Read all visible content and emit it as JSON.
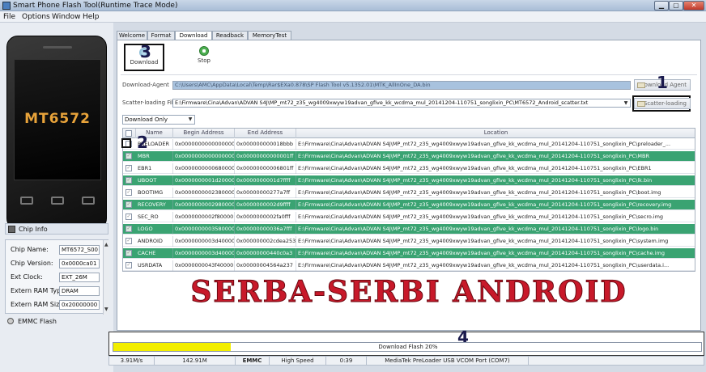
{
  "window": {
    "title": "Smart Phone Flash Tool(Runtime Trace Mode)",
    "min_glyph": "▁",
    "max_glyph": "▢",
    "close_glyph": "✕"
  },
  "menu": [
    "File",
    "Options",
    "Window",
    "Help"
  ],
  "phone": {
    "model": "MT6572"
  },
  "chip_info": {
    "header": "Chip Info",
    "rows": [
      {
        "label": "Chip Name:",
        "value": "MT6572_S00"
      },
      {
        "label": "Chip Version:",
        "value": "0x0000ca01"
      },
      {
        "label": "Ext Clock:",
        "value": "EXT_26M"
      },
      {
        "label": "Extern RAM Type:",
        "value": "DRAM"
      },
      {
        "label": "Extern RAM Size:",
        "value": "0x20000000"
      }
    ],
    "storage": "EMMC Flash"
  },
  "tabs": [
    "Welcome",
    "Format",
    "Download",
    "Readback",
    "MemoryTest"
  ],
  "active_tab": "Download",
  "toolbar": {
    "download_label": "Download",
    "stop_label": "Stop"
  },
  "annotations": {
    "m1": "1",
    "m2": "2",
    "m3": "3",
    "m4": "4"
  },
  "form": {
    "agent_label": "Download-Agent",
    "agent_path": "C:\\Users\\AMC\\AppData\\Local\\Temp\\Rar$EXa0.878\\SP Flash Tool v5.1352.01\\MTK_AllInOne_DA.bin",
    "agent_button": "Download Agent",
    "scatter_label": "Scatter-loading File",
    "scatter_path": "E:\\Firmware\\Cina\\Advan\\ADVAN S4J\\MP_mt72_z35_wg4009xwyw19advan_gfive_kk_wcdma_mul_20141204-110751_songlixin_PC\\MT6572_Android_scatter.txt",
    "scatter_button": "Scatter-loading",
    "mode": "Download Only",
    "dropdown_glyph": "▼"
  },
  "table": {
    "headers": [
      "Name",
      "Begin Address",
      "End Address",
      "Location"
    ],
    "rows": [
      {
        "name": "PRELOADER",
        "begin": "0x0000000000000000",
        "end": "0x000000000018bbb",
        "location": "E:\\Firmware\\Cina\\Advan\\ADVAN S4J\\MP_mt72_z35_wg4009xwyw19advan_gfive_kk_wcdma_mul_20141204-110751_songlixin_PC\\preloader_...",
        "style": "white",
        "checked": false
      },
      {
        "name": "MBR",
        "begin": "0x0000000000000000",
        "end": "0x00000000000001ff",
        "location": "E:\\Firmware\\Cina\\Advan\\ADVAN S4J\\MP_mt72_z35_wg4009xwyw19advan_gfive_kk_wcdma_mul_20141204-110751_songlixin_PC\\MBR",
        "style": "green",
        "checked": true
      },
      {
        "name": "EBR1",
        "begin": "0x0000000000680000",
        "end": "0x00000000006801ff",
        "location": "E:\\Firmware\\Cina\\Advan\\ADVAN S4J\\MP_mt72_z35_wg4009xwyw19advan_gfive_kk_wcdma_mul_20141204-110751_songlixin_PC\\EBR1",
        "style": "white",
        "checked": true
      },
      {
        "name": "UBOOT",
        "begin": "0x0000000001d20000",
        "end": "0x0000000001d7ffff",
        "location": "E:\\Firmware\\Cina\\Advan\\ADVAN S4J\\MP_mt72_z35_wg4009xwyw19advan_gfive_kk_wcdma_mul_20141204-110751_songlixin_PC\\lk.bin",
        "style": "green",
        "checked": true
      },
      {
        "name": "BOOTIMG",
        "begin": "0x0000000002380000",
        "end": "0x00000000277a7ff",
        "location": "E:\\Firmware\\Cina\\Advan\\ADVAN S4J\\MP_mt72_z35_wg4009xwyw19advan_gfive_kk_wcdma_mul_20141204-110751_songlixin_PC\\boot.img",
        "style": "white",
        "checked": true
      },
      {
        "name": "RECOVERY",
        "begin": "0x0000000002980000",
        "end": "0x0000000002d9ffff",
        "location": "E:\\Firmware\\Cina\\Advan\\ADVAN S4J\\MP_mt72_z35_wg4009xwyw19advan_gfive_kk_wcdma_mul_20141204-110751_songlixin_PC\\recovery.img",
        "style": "green",
        "checked": true
      },
      {
        "name": "SEC_RO",
        "begin": "0x0000000002f80000",
        "end": "0x0000000002fa0fff",
        "location": "E:\\Firmware\\Cina\\Advan\\ADVAN S4J\\MP_mt72_z35_wg4009xwyw19advan_gfive_kk_wcdma_mul_20141204-110751_songlixin_PC\\secro.img",
        "style": "white",
        "checked": true
      },
      {
        "name": "LOGO",
        "begin": "0x0000000003580000",
        "end": "0x00000000036a7fff",
        "location": "E:\\Firmware\\Cina\\Advan\\ADVAN S4J\\MP_mt72_z35_wg4009xwyw19advan_gfive_kk_wcdma_mul_20141204-110751_songlixin_PC\\logo.bin",
        "style": "green",
        "checked": true
      },
      {
        "name": "ANDROID",
        "begin": "0x0000000003d40000",
        "end": "0x000000002cdea253",
        "location": "E:\\Firmware\\Cina\\Advan\\ADVAN S4J\\MP_mt72_z35_wg4009xwyw19advan_gfive_kk_wcdma_mul_20141204-110751_songlixin_PC\\system.img",
        "style": "white",
        "checked": true
      },
      {
        "name": "CACHE",
        "begin": "0x0000000003d40000",
        "end": "0x00000000440c0a3",
        "location": "E:\\Firmware\\Cina\\Advan\\ADVAN S4J\\MP_mt72_z35_wg4009xwyw19advan_gfive_kk_wcdma_mul_20141204-110751_songlixin_PC\\cache.img",
        "style": "green",
        "checked": true
      },
      {
        "name": "USRDATA",
        "begin": "0x0000000043f40000",
        "end": "0x00000004564a237",
        "location": "E:\\Firmware\\Cina\\Advan\\ADVAN S4J\\MP_mt72_z35_wg4009xwyw19advan_gfive_kk_wcdma_mul_20141204-110751_songlixin_PC\\userdata.i...",
        "style": "white",
        "checked": true
      }
    ]
  },
  "watermark": "SERBA-SERBI ANDROID",
  "progress": {
    "text": "Download Flash 20%",
    "percent": 20,
    "color": "#f2ee00"
  },
  "status": {
    "speed": "3.91M/s",
    "size": "142.91M",
    "storage": "EMMC",
    "usb_speed": "High Speed",
    "time": "0:39",
    "port": "MediaTek PreLoader USB VCOM Port (COM7)"
  }
}
